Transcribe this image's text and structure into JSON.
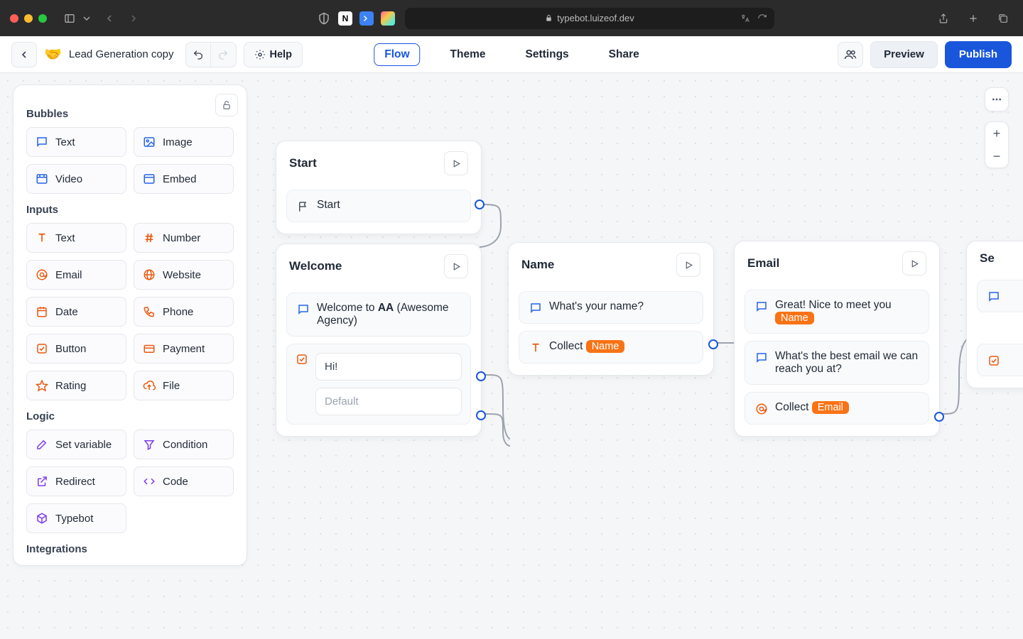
{
  "browser": {
    "url": "typebot.luizeof.dev"
  },
  "appbar": {
    "back_aria": "Back",
    "bot_emoji": "🤝",
    "bot_name": "Lead Generation copy",
    "help": "Help",
    "tabs": {
      "flow": "Flow",
      "theme": "Theme",
      "settings": "Settings",
      "share": "Share"
    },
    "preview": "Preview",
    "publish": "Publish"
  },
  "palette": {
    "bubbles_title": "Bubbles",
    "bubbles": {
      "text": "Text",
      "image": "Image",
      "video": "Video",
      "embed": "Embed"
    },
    "inputs_title": "Inputs",
    "inputs": {
      "text": "Text",
      "number": "Number",
      "email": "Email",
      "website": "Website",
      "date": "Date",
      "phone": "Phone",
      "button": "Button",
      "payment": "Payment",
      "rating": "Rating",
      "file": "File"
    },
    "logic_title": "Logic",
    "logic": {
      "setvar": "Set variable",
      "condition": "Condition",
      "redirect": "Redirect",
      "code": "Code",
      "typebot": "Typebot"
    },
    "integrations_title": "Integrations"
  },
  "nodes": {
    "start": {
      "title": "Start",
      "label": "Start"
    },
    "welcome": {
      "title": "Welcome",
      "line_prefix": "Welcome to ",
      "line_bold": "AA",
      "line_suffix": " (Awesome Agency)",
      "hi": "Hi!",
      "default": "Default"
    },
    "name": {
      "title": "Name",
      "q": "What's your name?",
      "collect": "Collect",
      "var": "Name"
    },
    "email": {
      "title": "Email",
      "greet": "Great! Nice to meet you",
      "greet_var": "Name",
      "q": "What's the best email we can reach you at?",
      "collect": "Collect",
      "var": "Email"
    },
    "next": {
      "title": "Se"
    }
  }
}
